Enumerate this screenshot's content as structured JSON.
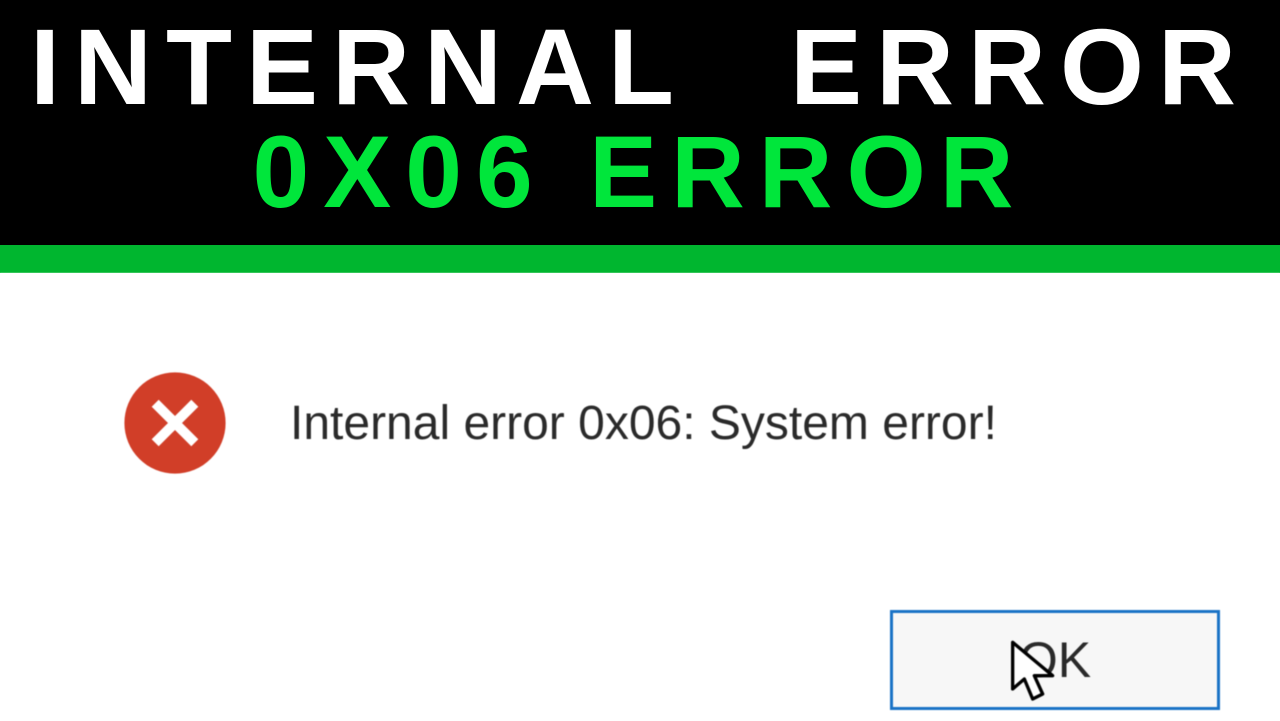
{
  "banner": {
    "line1": "INTERNAL ERROR",
    "line2": "0x06 Error"
  },
  "dialog": {
    "message": "Internal error 0x06: System error!",
    "ok_label": "OK"
  },
  "colors": {
    "banner_bg": "#000000",
    "banner_text": "#ffffff",
    "banner_code": "#00e63b",
    "strip": "#00b62f",
    "error_icon": "#d13e28",
    "button_border": "#1a73c6"
  }
}
